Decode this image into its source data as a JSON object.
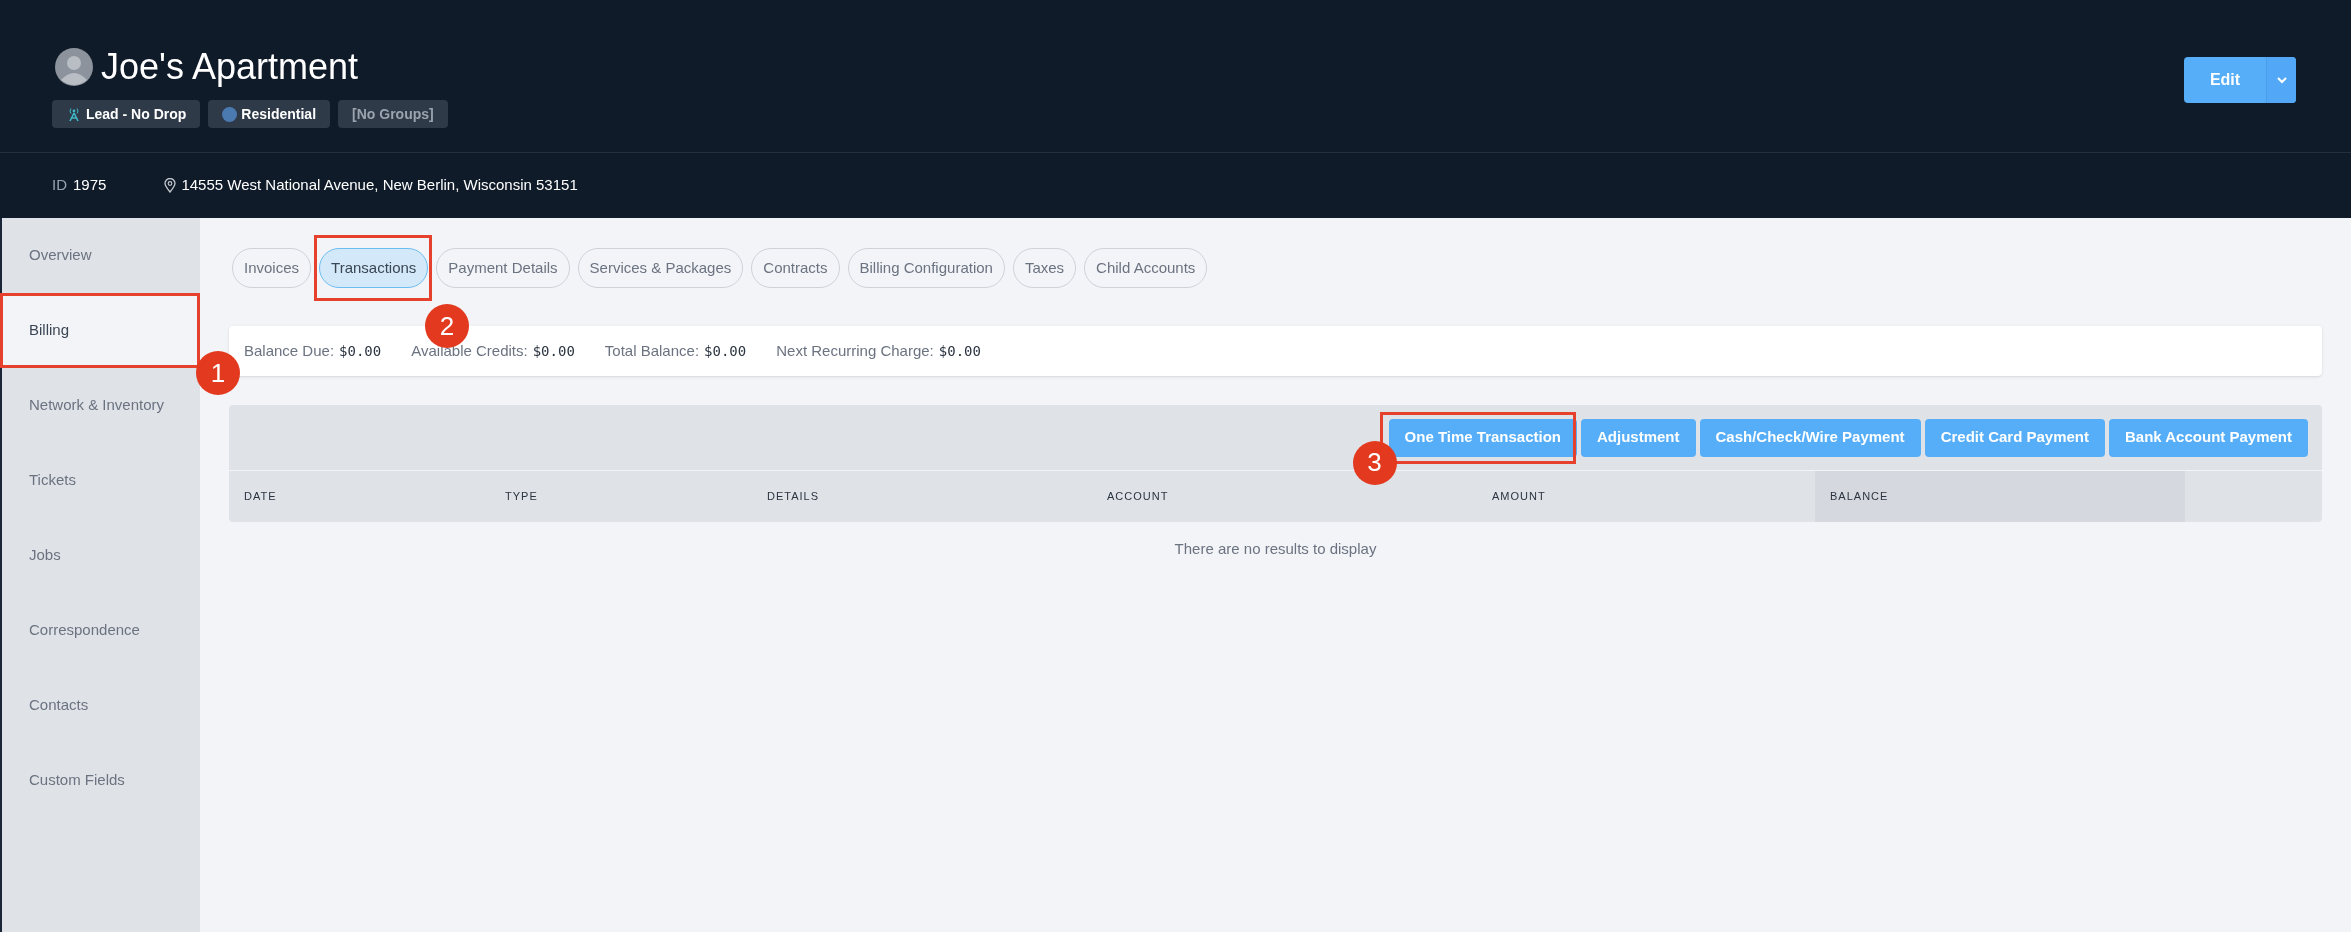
{
  "header": {
    "title": "Joe's Apartment",
    "chips": [
      {
        "kind": "lead",
        "label": "Lead - No Drop"
      },
      {
        "kind": "dot",
        "label": "Residential",
        "color": "#4a7ab0"
      },
      {
        "kind": "muted",
        "label": "[No Groups]"
      }
    ],
    "id_label": "ID",
    "id_value": "1975",
    "address": "14555 West National Avenue, New Berlin, Wisconsin 53151",
    "edit_button": "Edit"
  },
  "sidebar": {
    "items": [
      {
        "label": "Overview",
        "selected": false
      },
      {
        "label": "Billing",
        "selected": true,
        "annotation": "1"
      },
      {
        "label": "Network & Inventory",
        "selected": false
      },
      {
        "label": "Tickets",
        "selected": false
      },
      {
        "label": "Jobs",
        "selected": false
      },
      {
        "label": "Correspondence",
        "selected": false
      },
      {
        "label": "Contacts",
        "selected": false
      },
      {
        "label": "Custom Fields",
        "selected": false
      }
    ]
  },
  "tabs": [
    {
      "label": "Invoices",
      "selected": false
    },
    {
      "label": "Transactions",
      "selected": true,
      "annotation": "2"
    },
    {
      "label": "Payment Details",
      "selected": false
    },
    {
      "label": "Services & Packages",
      "selected": false
    },
    {
      "label": "Contracts",
      "selected": false
    },
    {
      "label": "Billing Configuration",
      "selected": false
    },
    {
      "label": "Taxes",
      "selected": false
    },
    {
      "label": "Child Accounts",
      "selected": false
    }
  ],
  "balances": [
    {
      "label": "Balance Due:",
      "value": "$0.00"
    },
    {
      "label": "Available Credits:",
      "value": "$0.00"
    },
    {
      "label": "Total Balance:",
      "value": "$0.00"
    },
    {
      "label": "Next Recurring Charge:",
      "value": "$0.00"
    }
  ],
  "actions": [
    {
      "label": "One Time Transaction",
      "annotation": "3"
    },
    {
      "label": "Adjustment"
    },
    {
      "label": "Cash/Check/Wire Payment"
    },
    {
      "label": "Credit Card Payment"
    },
    {
      "label": "Bank Account Payment"
    }
  ],
  "table": {
    "columns": [
      {
        "label": "DATE",
        "sorted": false
      },
      {
        "label": "TYPE",
        "sorted": false
      },
      {
        "label": "DETAILS",
        "sorted": false
      },
      {
        "label": "ACCOUNT",
        "sorted": false
      },
      {
        "label": "AMOUNT",
        "sorted": false
      },
      {
        "label": "BALANCE",
        "sorted": true
      }
    ],
    "empty_message": "There are no results to display"
  }
}
